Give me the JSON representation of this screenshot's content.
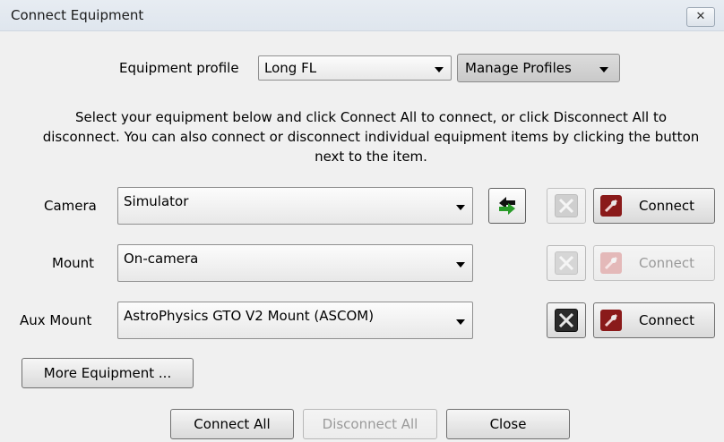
{
  "window": {
    "title": "Connect Equipment",
    "close_glyph": "✕"
  },
  "profile": {
    "label": "Equipment profile",
    "value": "Long FL",
    "manage_label": "Manage Profiles"
  },
  "instructions": "Select your equipment below and click Connect All to connect, or click Disconnect All to disconnect. You can also connect or disconnect individual equipment items by clicking the button next to the item.",
  "equipment": {
    "camera": {
      "label": "Camera",
      "value": "Simulator",
      "connect_label": "Connect",
      "enabled": true
    },
    "mount": {
      "label": "Mount",
      "value": "On-camera",
      "connect_label": "Connect",
      "enabled": false
    },
    "aux_mount": {
      "label": "Aux Mount",
      "value": "AstroPhysics GTO V2 Mount (ASCOM)",
      "connect_label": "Connect",
      "enabled": true
    }
  },
  "buttons": {
    "more_equipment": "More Equipment ...",
    "connect_all": "Connect All",
    "disconnect_all": "Disconnect All",
    "close": "Close"
  },
  "icons": {
    "swap": "swap-arrows-icon",
    "setup": "tools-icon",
    "plug": "plug-icon"
  },
  "colors": {
    "swap_green": "#2a9b2a",
    "plug_red": "#8a1a1a",
    "setup_dark": "#2b2b2b"
  }
}
